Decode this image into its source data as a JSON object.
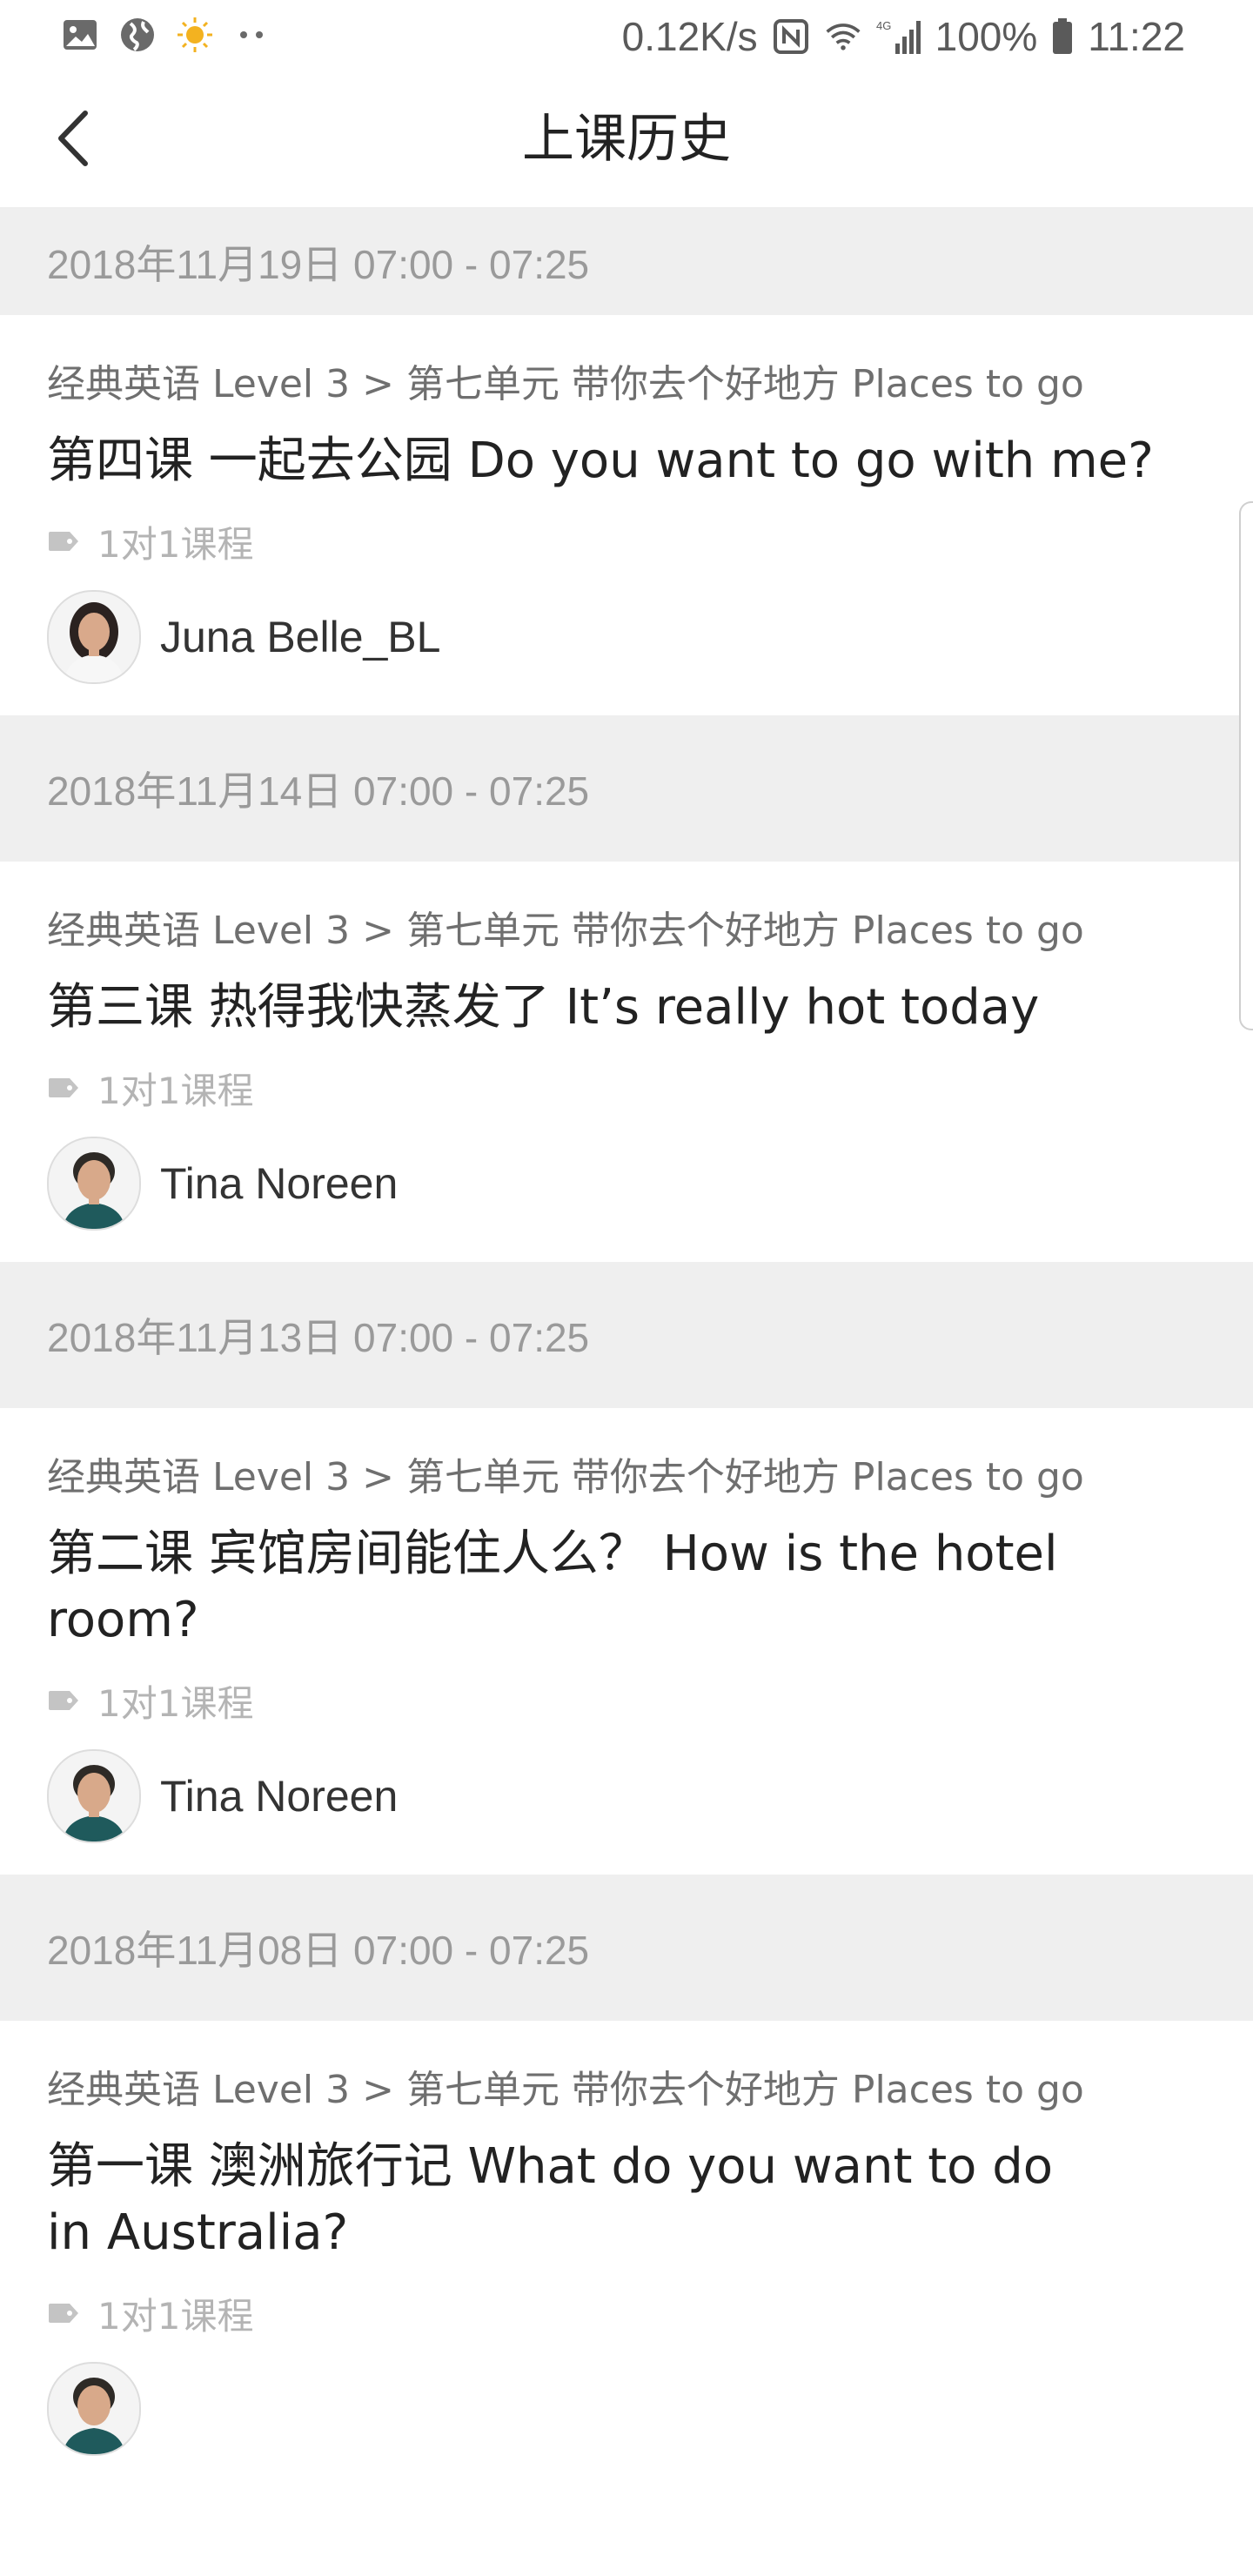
{
  "status_bar": {
    "icons_left": [
      "gallery-icon",
      "globe-icon",
      "sun-icon",
      "more-dots-icon"
    ],
    "net_speed": "0.12K/s",
    "signal_label": "4G",
    "battery": "100%",
    "time": "11:22",
    "icons_right": [
      "nfc-icon",
      "wifi-icon",
      "signal-icon",
      "battery-icon"
    ]
  },
  "header": {
    "title": "上课历史",
    "back_icon": "chevron-left-icon"
  },
  "lessons": [
    {
      "date": "2018年11月19日 07:00 - 07:25",
      "course": "经典英语 Level 3 > 第七单元 带你去个好地方 Places to go",
      "title": "第四课 一起去公园 Do you want to go with me?",
      "tag": "1对1课程",
      "teacher": "Juna Belle_BL"
    },
    {
      "date": "2018年11月14日 07:00 - 07:25",
      "course": "经典英语 Level 3 > 第七单元 带你去个好地方 Places to go",
      "title": "第三课 热得我快蒸发了 It’s really hot today",
      "tag": "1对1课程",
      "teacher": "Tina Noreen"
    },
    {
      "date": "2018年11月13日 07:00 - 07:25",
      "course": "经典英语 Level 3 > 第七单元 带你去个好地方 Places to go",
      "title": "第二课 宾馆房间能住人么？ How is the hotel room?",
      "tag": "1对1课程",
      "teacher": "Tina Noreen"
    },
    {
      "date": "2018年11月08日 07:00 - 07:25",
      "course": "经典英语 Level 3 > 第七单元 带你去个好地方 Places to go",
      "title": "第一课 澳洲旅行记 What do you want to do in Australia?",
      "tag": "1对1课程",
      "teacher": ""
    }
  ],
  "colors": {
    "date_bar_bg": "#efefef",
    "date_text": "#9a9a9a",
    "crumb_text": "#6f6f6f",
    "tag_text": "#b4b4b4",
    "title_text": "#222222"
  }
}
